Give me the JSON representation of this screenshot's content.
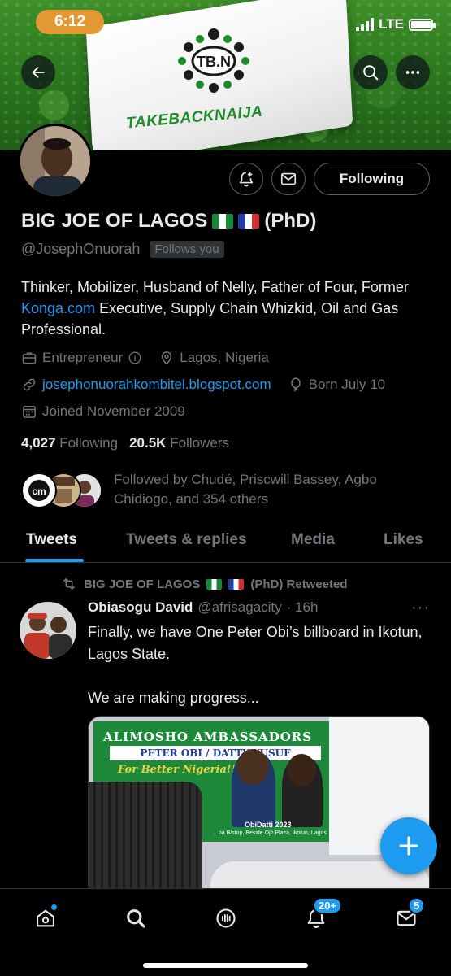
{
  "status_bar": {
    "time": "6:12",
    "network": "LTE",
    "battery_level": 1.0
  },
  "banner": {
    "flag_text": "TAKEBACKNAIJA",
    "logo_text": "TB.N"
  },
  "header_buttons": {
    "back_icon": "back-arrow-icon",
    "search_icon": "search-icon",
    "more_icon": "more-icon"
  },
  "profile": {
    "name": "BIG JOE OF LAGOS",
    "name_suffix": "(PhD)",
    "handle": "@JosephOnuorah",
    "follows_you": "Follows you",
    "following_button": "Following",
    "bio_part1": "Thinker, Mobilizer, Husband of Nelly, Father of Four, Former ",
    "bio_link": "Konga.com",
    "bio_part2": " Executive, Supply Chain Whizkid, Oil and Gas Professional.",
    "category": "Entrepreneur",
    "location": "Lagos, Nigeria",
    "website": "josephonuorahkombitel.blogspot.com",
    "birthday": "Born July 10",
    "joined": "Joined November 2009",
    "following_count": "4,027",
    "following_label": "Following",
    "followers_count": "20.5K",
    "followers_label": "Followers",
    "followed_by": "Followed by Chudé, Priscwill Bassey, Agbo Chidiogo, and 354 others"
  },
  "tabs": [
    {
      "label": "Tweets",
      "active": true
    },
    {
      "label": "Tweets & replies",
      "active": false
    },
    {
      "label": "Media",
      "active": false
    },
    {
      "label": "Likes",
      "active": false
    }
  ],
  "tweet": {
    "retweeted_by": "BIG JOE OF LAGOS",
    "retweeted_suffix": "(PhD) Retweeted",
    "author": "Obiasogu David",
    "handle": "@afrisagacity",
    "time": "· 16h",
    "more": "···",
    "text": "Finally, we have One Peter Obi’s billboard in Ikotun, Lagos State.\n\nWe are making progress...",
    "billboard": {
      "line1": "ALIMOSHO AMBASSADORS",
      "line2": "PETER OBI / DATTY YUSUF",
      "line3": "For Better Nigeria!!!",
      "line4": "ObiDatti 2023",
      "line5": "...ba B/stop, Beside Ojb Plaza, Ikotun, Lagos"
    }
  },
  "bottom_nav": {
    "notifications_badge": "20+",
    "messages_badge": "5"
  },
  "colors": {
    "accent": "#1d9bf0",
    "background": "#000000",
    "muted": "#71767b",
    "text": "#e7e9ea"
  }
}
